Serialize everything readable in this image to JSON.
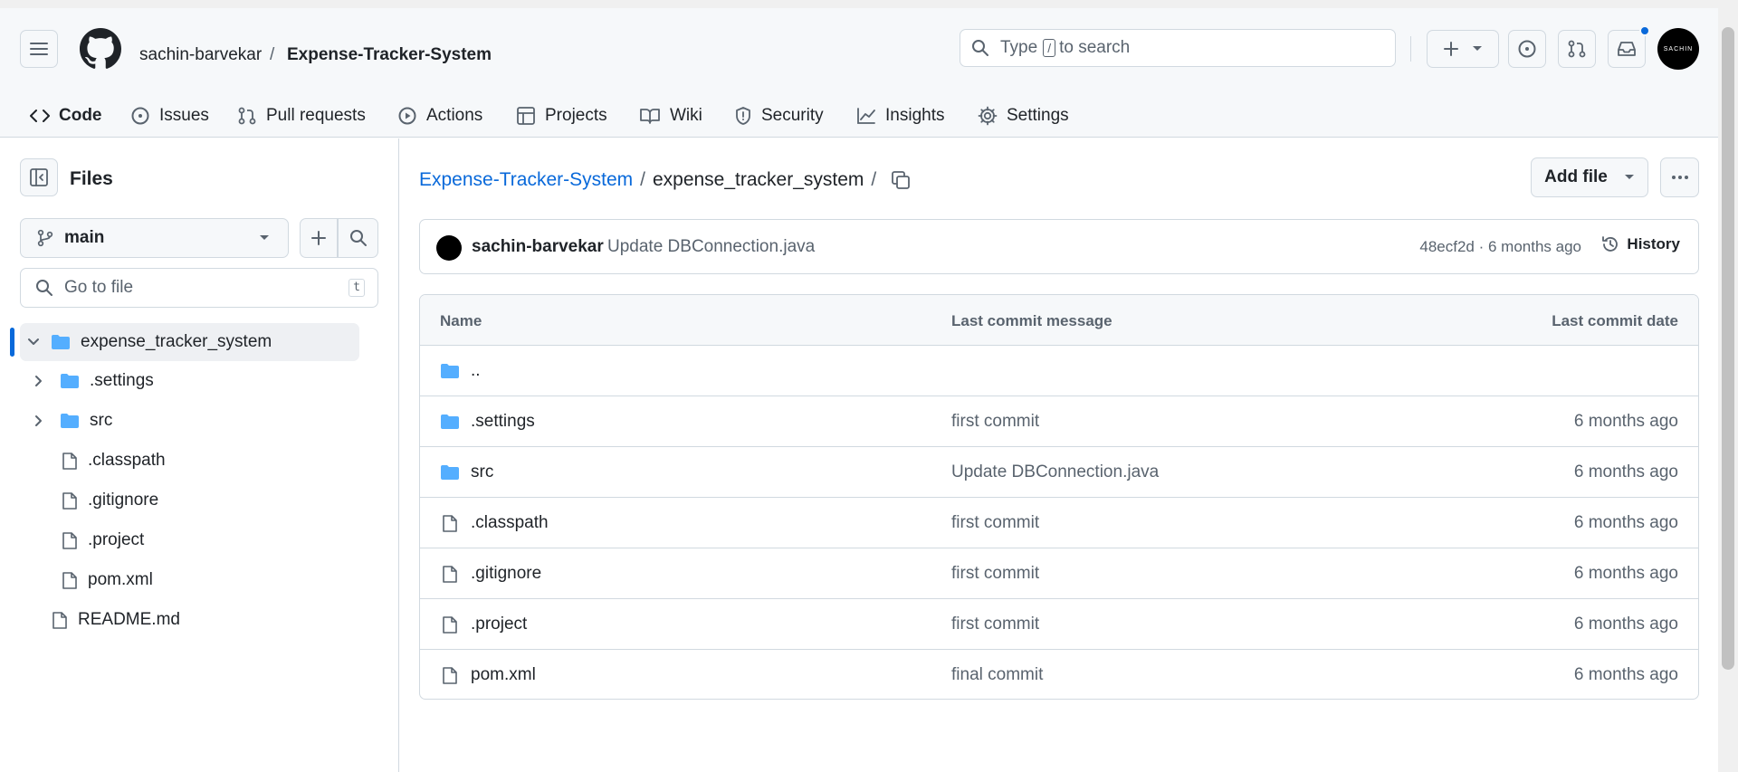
{
  "header": {
    "owner": "sachin-barvekar",
    "separator": "/",
    "repo": "Expense-Tracker-System",
    "search": {
      "prefix": "Type",
      "key": "/",
      "suffix": "to search"
    },
    "avatar_text": "SACHIN"
  },
  "tabs": [
    {
      "label": "Code",
      "icon": "code-icon"
    },
    {
      "label": "Issues",
      "icon": "issue-icon"
    },
    {
      "label": "Pull requests",
      "icon": "pull-request-icon"
    },
    {
      "label": "Actions",
      "icon": "play-icon"
    },
    {
      "label": "Projects",
      "icon": "table-icon"
    },
    {
      "label": "Wiki",
      "icon": "book-icon"
    },
    {
      "label": "Security",
      "icon": "shield-icon"
    },
    {
      "label": "Insights",
      "icon": "graph-icon"
    },
    {
      "label": "Settings",
      "icon": "gear-icon"
    }
  ],
  "sidebar": {
    "title": "Files",
    "branch": "main",
    "goto_placeholder": "Go to file",
    "goto_key": "t",
    "tree": [
      {
        "name": "expense_tracker_system",
        "type": "folder",
        "expanded": true,
        "selected": true
      },
      {
        "name": ".settings",
        "type": "folder"
      },
      {
        "name": "src",
        "type": "folder"
      },
      {
        "name": ".classpath",
        "type": "file"
      },
      {
        "name": ".gitignore",
        "type": "file"
      },
      {
        "name": ".project",
        "type": "file"
      },
      {
        "name": "pom.xml",
        "type": "file"
      },
      {
        "name": "README.md",
        "type": "file"
      }
    ]
  },
  "main": {
    "path_repo": "Expense-Tracker-System",
    "path_sep": "/",
    "path_dir": "expense_tracker_system",
    "path_trailing": "/",
    "add_file_label": "Add file",
    "commit": {
      "author": "sachin-barvekar",
      "message": "Update DBConnection.java",
      "meta": "48ecf2d · 6 months ago",
      "history_label": "History"
    },
    "table": {
      "headers": {
        "name": "Name",
        "message": "Last commit message",
        "date": "Last commit date"
      },
      "rows": [
        {
          "name": "..",
          "type": "folder",
          "message": "",
          "date": ""
        },
        {
          "name": ".settings",
          "type": "folder",
          "message": "first commit",
          "date": "6 months ago"
        },
        {
          "name": "src",
          "type": "folder",
          "message": "Update DBConnection.java",
          "date": "6 months ago"
        },
        {
          "name": ".classpath",
          "type": "file",
          "message": "first commit",
          "date": "6 months ago"
        },
        {
          "name": ".gitignore",
          "type": "file",
          "message": "first commit",
          "date": "6 months ago"
        },
        {
          "name": ".project",
          "type": "file",
          "message": "first commit",
          "date": "6 months ago"
        },
        {
          "name": "pom.xml",
          "type": "file",
          "message": "final commit",
          "date": "6 months ago"
        }
      ]
    }
  },
  "colors": {
    "accent": "#0969da",
    "folder": "#54aeff",
    "tab_underline": "#fd8c73",
    "notification_dot": "#0969da"
  }
}
